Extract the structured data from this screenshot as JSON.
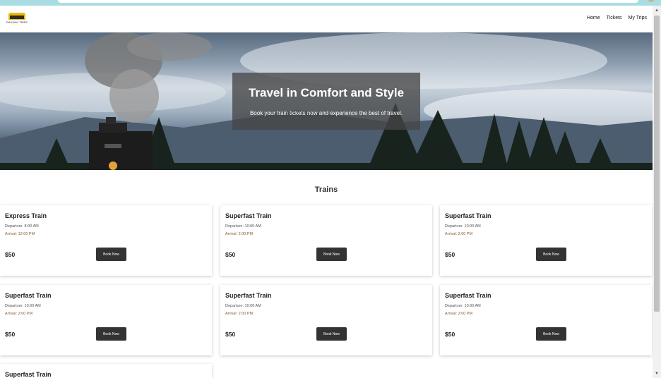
{
  "nav": {
    "logo_text": "RAILWAY TRIPS",
    "links": [
      "Home",
      "Tickets",
      "My Trips"
    ]
  },
  "hero": {
    "title": "Travel in Comfort and Style",
    "subtitle": "Book your train tickets now and experience the best of travel."
  },
  "trains_section": {
    "title": "Trains",
    "cards": [
      {
        "name": "Express Train",
        "departure": "Departure: 8:00 AM",
        "arrival": "Arrival: 12:00 PM",
        "price": "$50",
        "button": "Book Now"
      },
      {
        "name": "Superfast Train",
        "departure": "Departure: 10:00 AM",
        "arrival": "Arrival: 2:00 PM",
        "price": "$50",
        "button": "Book Now"
      },
      {
        "name": "Superfast Train",
        "departure": "Departure: 10:00 AM",
        "arrival": "Arrival: 2:00 PM",
        "price": "$50",
        "button": "Book Now"
      },
      {
        "name": "Superfast Train",
        "departure": "Departure: 10:00 AM",
        "arrival": "Arrival: 2:00 PM",
        "price": "$50",
        "button": "Book Now"
      },
      {
        "name": "Superfast Train",
        "departure": "Departure: 10:00 AM",
        "arrival": "Arrival: 2:00 PM",
        "price": "$50",
        "button": "Book Now"
      },
      {
        "name": "Superfast Train",
        "departure": "Departure: 10:00 AM",
        "arrival": "Arrival: 2:00 PM",
        "price": "$50",
        "button": "Book Now"
      },
      {
        "name": "Superfast Train"
      }
    ]
  }
}
